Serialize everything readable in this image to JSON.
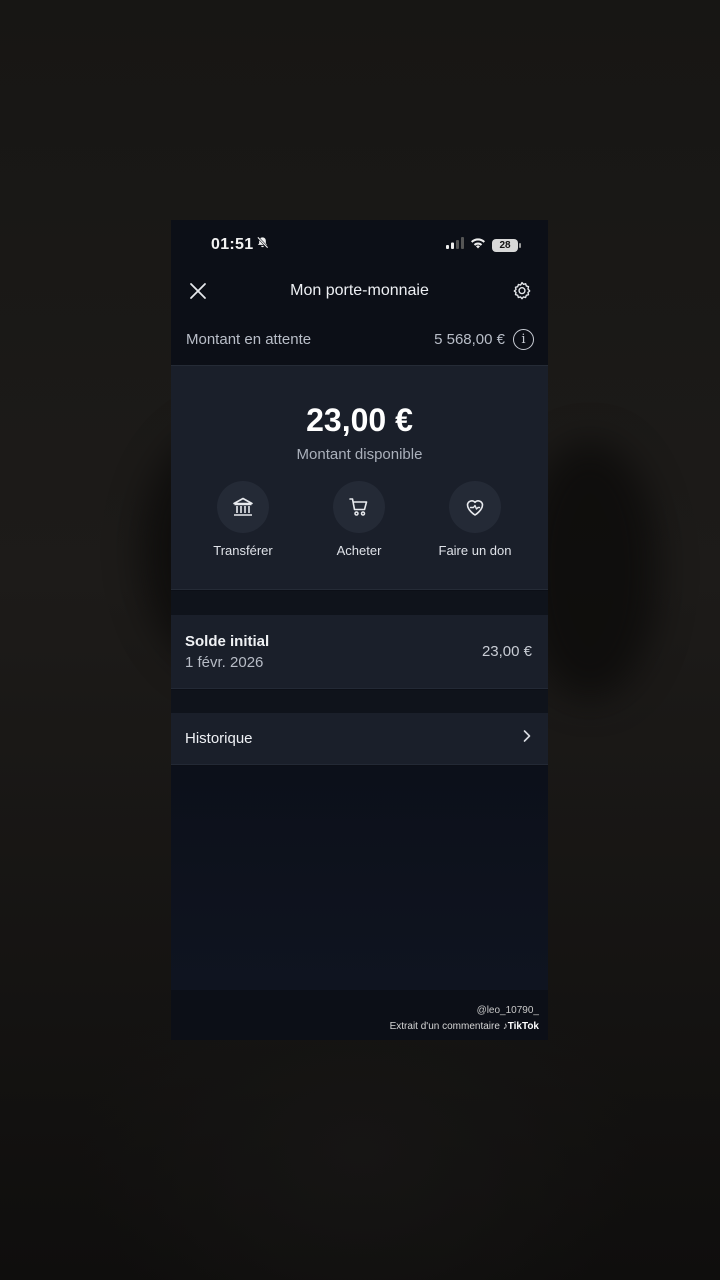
{
  "status_bar": {
    "time": "01:51",
    "battery": "28"
  },
  "nav": {
    "title": "Mon porte-monnaie"
  },
  "pending": {
    "label": "Montant en attente",
    "value": "5 568,00 €"
  },
  "balance": {
    "amount": "23,00 €",
    "label": "Montant disponible"
  },
  "actions": [
    {
      "label": "Transférer",
      "icon": "bank-icon"
    },
    {
      "label": "Acheter",
      "icon": "cart-icon"
    },
    {
      "label": "Faire un don",
      "icon": "heart-hand-icon"
    }
  ],
  "solde": {
    "title": "Solde initial",
    "date": "1 févr. 2026",
    "value": "23,00 €"
  },
  "history": {
    "label": "Historique"
  },
  "watermark": {
    "handle": "@leo_10790_",
    "caption": "Extrait d'un commentaire",
    "brand": "TikTok"
  }
}
